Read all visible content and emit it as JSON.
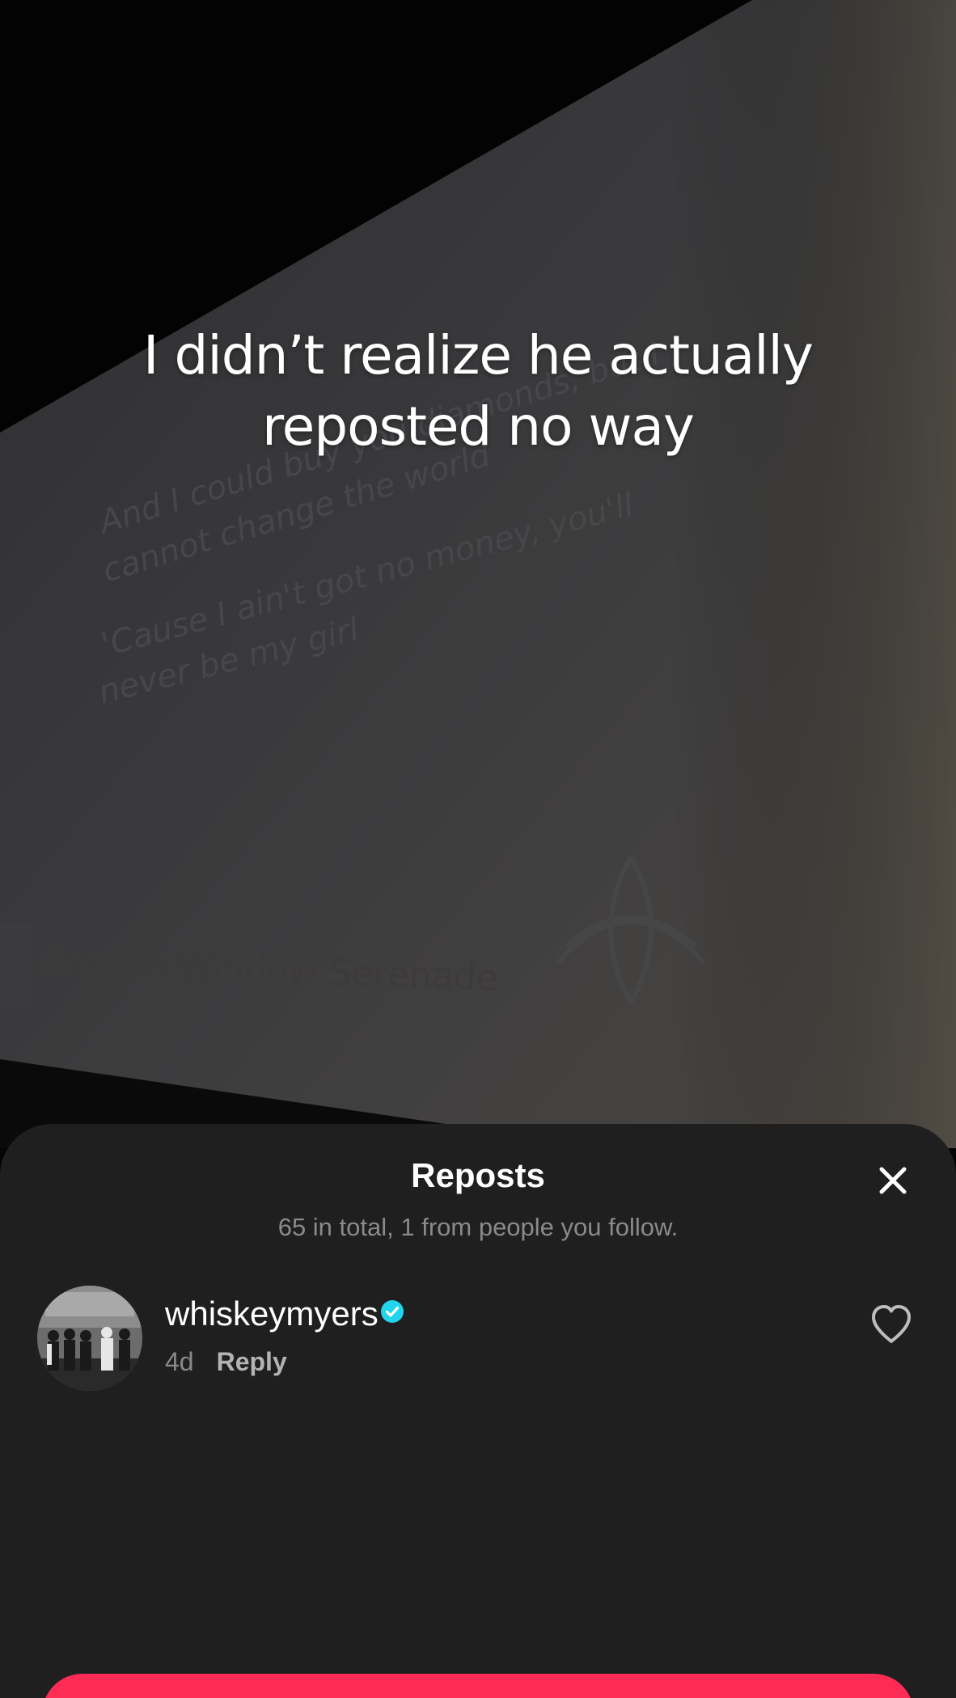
{
  "video": {
    "caption_lines": [
      "I didn’t realize he actually",
      "reposted no way"
    ],
    "screen_lyrics": [
      "And I could buy you diamonds, but I",
      "cannot change the world",
      "'Cause I ain't got no money, you'll",
      "never be my girl"
    ],
    "screen_song_title": "Broken Window Serenade"
  },
  "reposts_sheet": {
    "title": "Reposts",
    "subtitle": "65 in total, 1 from people you follow.",
    "close_icon": "close-icon",
    "items": [
      {
        "username": "whiskeymyers",
        "verified": true,
        "time": "4d",
        "reply_label": "Reply",
        "like_icon": "heart-outline-icon"
      }
    ]
  },
  "colors": {
    "sheet_background": "#1f1f1f",
    "verified_badge": "#20d5ec",
    "primary_button": "#fe2c55",
    "secondary_text": "#8a8a8a"
  }
}
